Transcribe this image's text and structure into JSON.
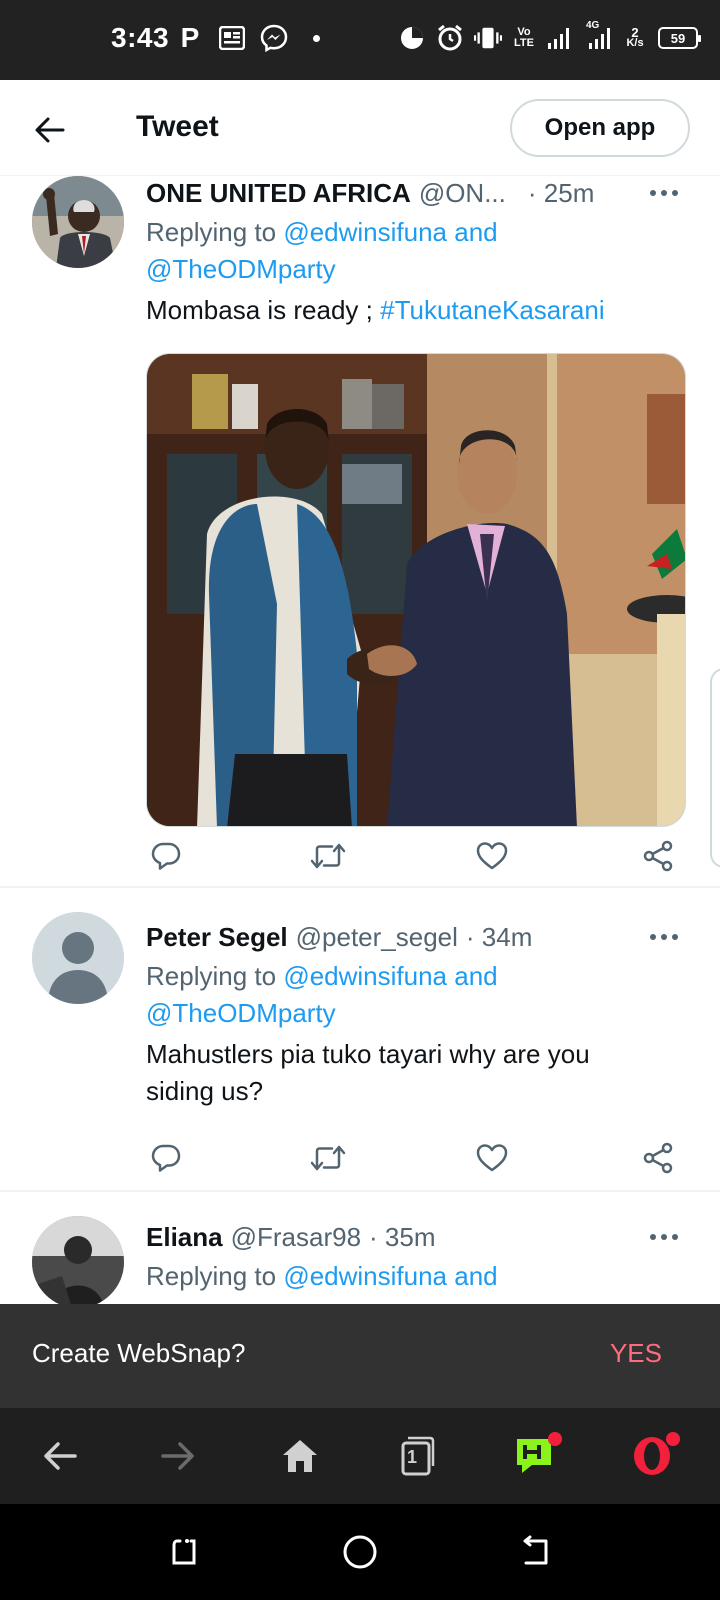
{
  "status_bar": {
    "time": "3:43",
    "network_label": "Vo LTE",
    "signal_label": "4G",
    "speed_value": "2",
    "speed_unit": "K/s",
    "battery": "59"
  },
  "header": {
    "title": "Tweet",
    "open_app": "Open app"
  },
  "tweets": [
    {
      "name": "ONE UNITED AFRICA",
      "handle": "@ON...",
      "time": "· 25m",
      "replying_prefix": "Replying to",
      "replying_line1": "@edwinsifuna and",
      "replying_line2": "@TheODMparty",
      "text": "Mombasa is ready ;",
      "hashtag": "#TukutaneKasarani"
    },
    {
      "name": "Peter Segel",
      "handle": "@peter_segel",
      "time": "· 34m",
      "replying_prefix": "Replying to",
      "replying_line1": "@edwinsifuna and",
      "replying_line2": "@TheODMparty",
      "text_line1": "Mahustlers pia tuko tayari why are you",
      "text_line2": "siding us?"
    },
    {
      "name": "Eliana",
      "handle": "@Frasar98",
      "time": "· 35m",
      "replying_prefix": "Replying to",
      "replying_line1": "@edwinsifuna and"
    }
  ],
  "snackbar": {
    "text": "Create WebSnap?",
    "action": "YES",
    "action_color": "#ff6b7f"
  },
  "browser_bar": {
    "tab_count": "1"
  },
  "colors": {
    "link": "#1d9bf0",
    "secondary_text": "#536471",
    "opera_red": "#f2203a",
    "hype_green": "#8bf21c"
  },
  "icons": [
    "back-arrow-icon",
    "more-icon",
    "reply-icon",
    "retweet-icon",
    "like-icon",
    "share-icon",
    "home-icon",
    "tabs-icon",
    "hype-icon",
    "opera-icon"
  ]
}
